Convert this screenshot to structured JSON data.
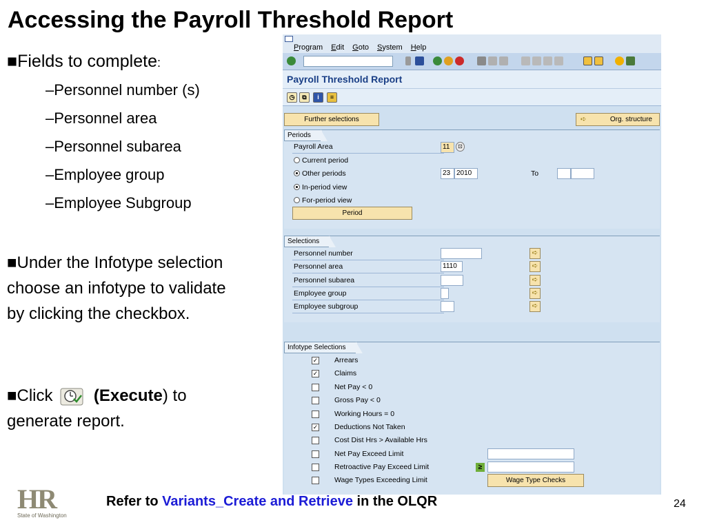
{
  "slide": {
    "title": "Accessing the Payroll Threshold Report",
    "fields_heading": "■Fields to complete",
    "fields_colon": ":",
    "fields": [
      "–Personnel number (s)",
      "–Personnel area",
      "–Personnel subarea",
      "–Employee group",
      "–Employee Subgroup"
    ],
    "infotype_text": "■Under the Infotype selection choose an infotype to validate by clicking the checkbox.",
    "click_prefix": "■Click",
    "execute_label": "(Execute",
    "execute_suffix": ") to generate report.",
    "footer_prefix": "Refer to",
    "footer_link": "Variants_Create and Retrieve",
    "footer_suffix": "in the OLQR",
    "page_number": "24",
    "logo_text": "HR",
    "logo_subtext": "State of Washington"
  },
  "sap": {
    "menu": [
      "Program",
      "Edit",
      "Goto",
      "System",
      "Help"
    ],
    "title": "Payroll Threshold Report",
    "further_selections": "Further selections",
    "org_structure": "Org. structure",
    "periods": {
      "tab": "Periods",
      "payroll_area_label": "Payroll Area",
      "payroll_area_value": "11",
      "current_period": "Current period",
      "other_periods": "Other periods",
      "period_value": "23",
      "year_value": "2010",
      "to_label": "To",
      "in_period_view": "In-period view",
      "for_period_view": "For-period view",
      "period_button": "Period"
    },
    "selections": {
      "tab": "Selections",
      "rows": [
        {
          "label": "Personnel number",
          "value": ""
        },
        {
          "label": "Personnel area",
          "value": "1110"
        },
        {
          "label": "Personnel subarea",
          "value": ""
        },
        {
          "label": "Employee group",
          "value": ""
        },
        {
          "label": "Employee subgroup",
          "value": ""
        }
      ]
    },
    "infotype": {
      "tab": "Infotype Selections",
      "items": [
        {
          "label": "Arrears",
          "checked": true
        },
        {
          "label": "Claims",
          "checked": true
        },
        {
          "label": "Net Pay < 0",
          "checked": false
        },
        {
          "label": "Gross Pay < 0",
          "checked": false
        },
        {
          "label": "Working Hours = 0",
          "checked": false
        },
        {
          "label": "Deductions Not Taken",
          "checked": true
        },
        {
          "label": "Cost Dist Hrs > Available Hrs",
          "checked": false
        },
        {
          "label": "Net Pay Exceed Limit",
          "checked": false
        },
        {
          "label": "Retroactive Pay Exceed Limit",
          "checked": false
        },
        {
          "label": "Wage Types Exceeding Limit",
          "checked": false
        }
      ],
      "wage_type_checks": "Wage Type Checks",
      "ge_symbol": "≥"
    },
    "colors": {
      "accent": "#1a3f86",
      "button": "#f7e3ad",
      "panel": "#d6e4f2"
    }
  }
}
